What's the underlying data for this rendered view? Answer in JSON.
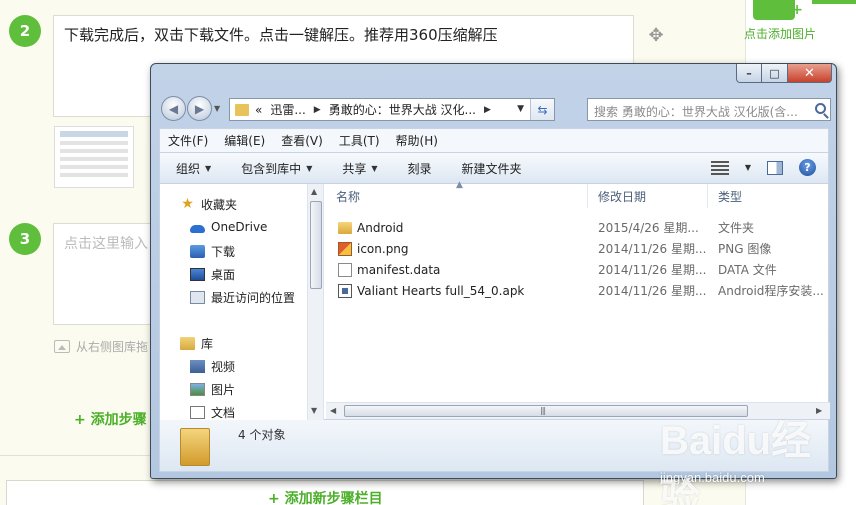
{
  "editor": {
    "step2": {
      "number": "2",
      "text": "下载完成后，双击下载文件。点击一键解压。推荐用360压缩解压"
    },
    "step3": {
      "number": "3",
      "placeholder": "点击这里输入"
    },
    "hint": "从右侧图库拖",
    "add_step": "+ 添加步骤",
    "add_new_column": "+ 添加新步骤栏目",
    "add_image": "点击添加图片"
  },
  "explorer": {
    "window_controls": {
      "minimize": "–",
      "maximize": "□",
      "close": "✕"
    },
    "address": {
      "prefix": "«",
      "segments": [
        "迅雷...",
        "勇敢的心：世界大战 汉化..."
      ]
    },
    "search_placeholder": "搜索 勇敢的心：世界大战 汉化版(含...",
    "menu": [
      "文件(F)",
      "编辑(E)",
      "查看(V)",
      "工具(T)",
      "帮助(H)"
    ],
    "toolbar": [
      "组织",
      "包含到库中",
      "共享",
      "刻录",
      "新建文件夹"
    ],
    "nav_pane": {
      "favorites": "收藏夹",
      "favorite_items": [
        "OneDrive",
        "下载",
        "桌面",
        "最近访问的位置"
      ],
      "libraries": "库",
      "library_items": [
        "视频",
        "图片",
        "文档"
      ]
    },
    "columns": {
      "name": "名称",
      "modified": "修改日期",
      "type": "类型"
    },
    "files": [
      {
        "name": "Android",
        "modified": "2015/4/26 星期...",
        "type": "文件夹",
        "icon": "folder-icon"
      },
      {
        "name": "icon.png",
        "modified": "2014/11/26 星期...",
        "type": "PNG 图像",
        "icon": "png-file-icon"
      },
      {
        "name": "manifest.data",
        "modified": "2014/11/26 星期...",
        "type": "DATA 文件",
        "icon": "data-file-icon"
      },
      {
        "name": "Valiant Hearts full_54_0.apk",
        "modified": "2014/11/26 星期...",
        "type": "Android程序安装...",
        "icon": "apk-file-icon"
      }
    ],
    "status": "4 个对象"
  },
  "watermark": {
    "brand": "Baidu经验",
    "url": "jingyan.baidu.com"
  }
}
